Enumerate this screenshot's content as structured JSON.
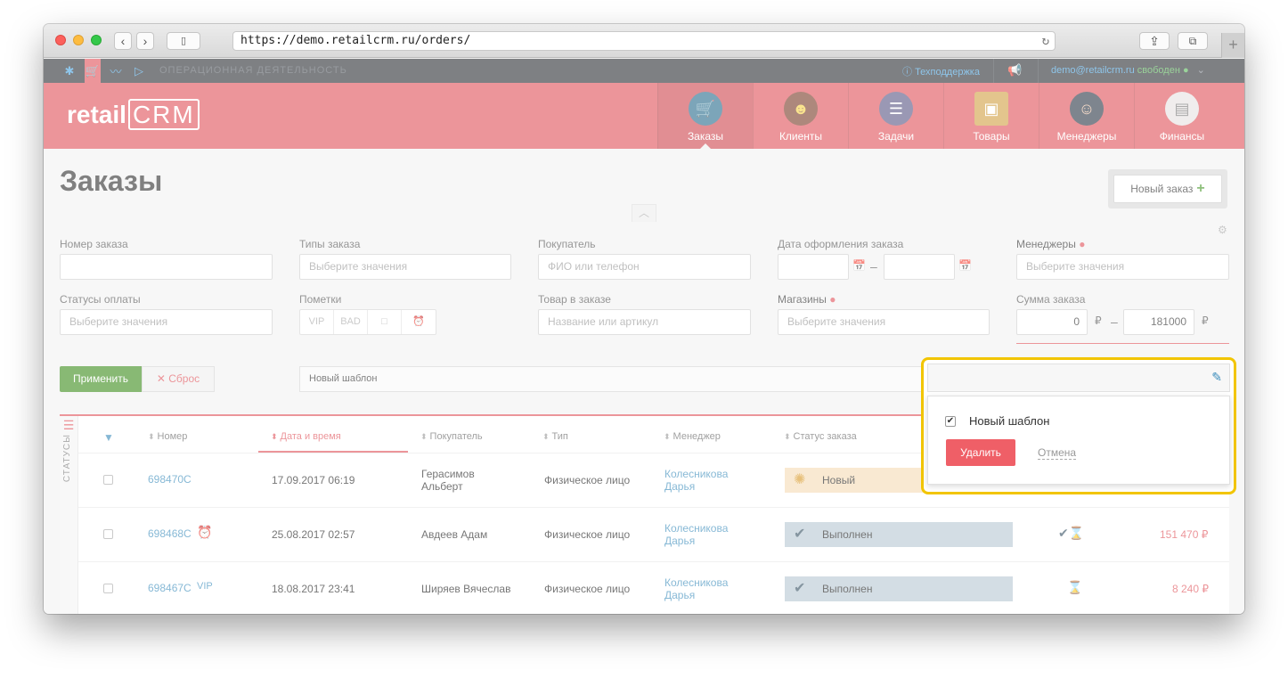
{
  "browser": {
    "url": "https://demo.retailcrm.ru/orders/"
  },
  "topbar": {
    "section": "ОПЕРАЦИОННАЯ ДЕЯТЕЛЬНОСТЬ",
    "support": "Техподдержка",
    "user_email": "demo@retailcrm.ru",
    "user_status": "свободен"
  },
  "header": {
    "logo_prefix": "retail",
    "logo_suffix": "CRM",
    "nav": [
      {
        "label": "Заказы",
        "icon": "cart-icon",
        "color": "#2c6e8f"
      },
      {
        "label": "Клиенты",
        "icon": "user-icon",
        "color": "#7b3f2d"
      },
      {
        "label": "Задачи",
        "icon": "list-icon",
        "color": "#5d5a86"
      },
      {
        "label": "Товары",
        "icon": "box-icon",
        "color": "#d2a247"
      },
      {
        "label": "Менеджеры",
        "icon": "manager-icon",
        "color": "#2f3b4a"
      },
      {
        "label": "Финансы",
        "icon": "finance-icon",
        "color": "#e7e2e2"
      }
    ]
  },
  "page": {
    "title": "Заказы",
    "new_order": "Новый заказ"
  },
  "filters": {
    "order_number": {
      "label": "Номер заказа",
      "placeholder": ""
    },
    "order_types": {
      "label": "Типы заказа",
      "placeholder": "Выберите значения"
    },
    "buyer": {
      "label": "Покупатель",
      "placeholder": "ФИО или телефон"
    },
    "order_date": {
      "label": "Дата оформления заказа"
    },
    "managers": {
      "label": "Менеджеры",
      "placeholder": "Выберите значения"
    },
    "payment_status": {
      "label": "Статусы оплаты",
      "placeholder": "Выберите значения"
    },
    "marks": {
      "label": "Пометки",
      "items": [
        "VIP",
        "BAD",
        "□",
        "⏰"
      ]
    },
    "product": {
      "label": "Товар в заказе",
      "placeholder": "Название или артикул"
    },
    "shops": {
      "label": "Магазины",
      "placeholder": "Выберите значения"
    },
    "sum": {
      "label": "Сумма заказа",
      "from": "0",
      "to": "181000",
      "currency": "₽"
    },
    "apply": "Применить",
    "reset": "Сброс",
    "template": "Новый шаблон"
  },
  "table": {
    "side_label": "СТАТУСЫ",
    "columns": [
      "Номер",
      "Дата и время",
      "Покупатель",
      "Тип",
      "Менеджер",
      "Статус заказа"
    ],
    "rows": [
      {
        "number": "698470C",
        "date": "17.09.2017 06:19",
        "buyer1": "Герасимов",
        "buyer2": "Альберт",
        "type": "Физическое лицо",
        "manager1": "Колесникова",
        "manager2": "Дарья",
        "status": "Новый",
        "mark": "",
        "price": ""
      },
      {
        "number": "698468C",
        "date": "25.08.2017 02:57",
        "buyer1": "Авдеев Адам",
        "buyer2": "",
        "type": "Физическое лицо",
        "manager1": "Колесникова",
        "manager2": "Дарья",
        "status": "Выполнен",
        "mark": "⏰",
        "price": "151 470 ₽"
      },
      {
        "number": "698467C",
        "date": "18.08.2017 23:41",
        "buyer1": "Ширяев Вячеслав",
        "buyer2": "",
        "type": "Физическое лицо",
        "manager1": "Колесникова",
        "manager2": "Дарья",
        "status": "Выполнен",
        "mark": "VIP",
        "price": "8 240 ₽"
      }
    ]
  },
  "popup": {
    "template_name": "Новый шаблон",
    "delete": "Удалить",
    "cancel": "Отмена"
  },
  "colors": {
    "brand": "#e0555c",
    "highlight": "#f2c500",
    "apply": "#3f8f1f"
  }
}
